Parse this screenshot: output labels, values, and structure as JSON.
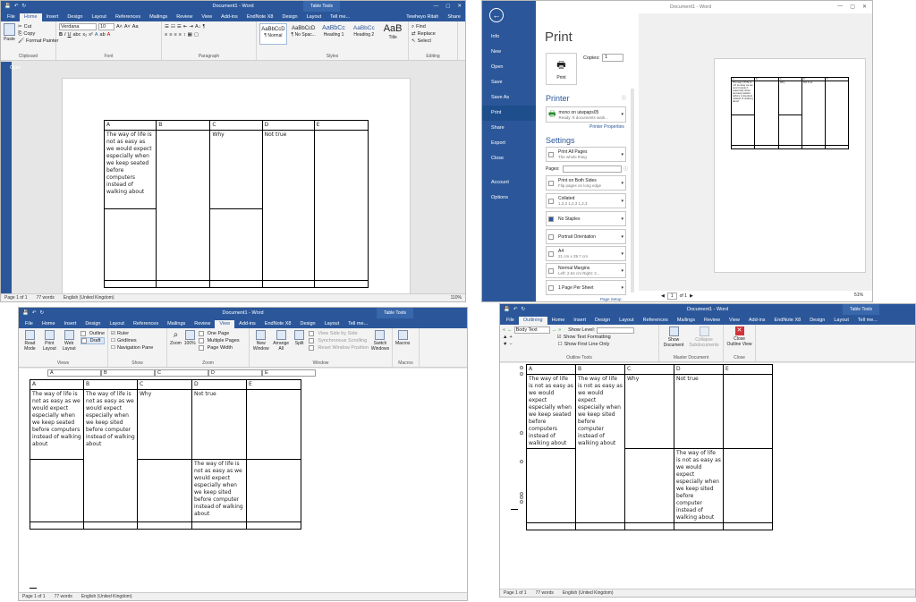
{
  "common": {
    "doc_title": "Document1 - Word",
    "table_tools": "Table Tools",
    "user": "Tewheyo Ritah",
    "share": "Share",
    "tell_me": "Tell me...",
    "ctl": {
      "min": "—",
      "max": "▢",
      "close": "✕"
    },
    "col_letters": [
      "A",
      "B",
      "C",
      "D",
      "E"
    ],
    "cell_text_1": "The way of life is not as easy as we would expect especially when we keep seated before computers instead of walking about",
    "cell_text_2": "The way of life is not as easy as we would expect especially when we keep sited before computer instead of walking about",
    "cell_why": "Why",
    "cell_not_true": "Not true"
  },
  "win1": {
    "tabs": [
      "File",
      "Home",
      "Insert",
      "Design",
      "Layout",
      "References",
      "Mailings",
      "Review",
      "View",
      "Add-ins",
      "EndNote X8",
      "Design",
      "Layout"
    ],
    "clipboard": {
      "paste": "Paste",
      "cut": "Cut",
      "copy": "Copy",
      "painter": "Format Painter",
      "label": "Clipboard"
    },
    "font": {
      "name": "Verdana",
      "size": "10",
      "label": "Font"
    },
    "paragraph_label": "Paragraph",
    "styles": [
      {
        "sample": "AaBbCcD",
        "name": "¶ Normal"
      },
      {
        "sample": "AaBbCcD",
        "name": "¶ No Spac..."
      },
      {
        "sample": "AaBbCc",
        "name": "Heading 1"
      },
      {
        "sample": "AaBbCc",
        "name": "Heading 2"
      },
      {
        "sample": "AaB",
        "name": "Title"
      }
    ],
    "styles_label": "Styles",
    "editing": {
      "find": "Find",
      "replace": "Replace",
      "select": "Select",
      "label": "Editing"
    },
    "nav_open": "Open",
    "status": {
      "page": "Page 1 of 1",
      "words": "77 words",
      "lang": "English (United Kingdom)",
      "zoom": "110%"
    }
  },
  "win2": {
    "side": [
      "Info",
      "New",
      "Open",
      "Save",
      "Save As",
      "Print",
      "Share",
      "Export",
      "Close",
      "Account",
      "Options"
    ],
    "heading": "Print",
    "copies_label": "Copies:",
    "copies_value": "1",
    "print_btn": "Print",
    "printer_heading": "Printer",
    "printer_name": "mono on uiwpaps05",
    "printer_status": "Ready: 8 documents waiti...",
    "printer_props": "Printer Properties",
    "settings_heading": "Settings",
    "settings": [
      {
        "main": "Print All Pages",
        "sub": "The whole thing"
      },
      {
        "main": "Print on Both Sides",
        "sub": "Flip pages on long edge"
      },
      {
        "main": "Collated",
        "sub": "1,2,3   1,2,3   1,2,3"
      },
      {
        "main": "No Staples",
        "sub": ""
      },
      {
        "main": "Portrait Orientation",
        "sub": ""
      },
      {
        "main": "A4",
        "sub": "21 cm x 29.7 cm"
      },
      {
        "main": "Normal Margins",
        "sub": "Left: 2.54 cm   Right: 2..."
      },
      {
        "main": "1 Page Per Sheet",
        "sub": ""
      }
    ],
    "pages_label": "Pages:",
    "page_setup": "Page Setup",
    "nav_page": "1",
    "nav_of": "of 1",
    "zoom": "51%"
  },
  "win3": {
    "tabs": [
      "File",
      "Home",
      "Insert",
      "Design",
      "Layout",
      "References",
      "Mailings",
      "Review",
      "View",
      "Add-ins",
      "EndNote X8",
      "Design",
      "Layout"
    ],
    "views": {
      "read": "Read Mode",
      "print": "Print Layout",
      "web": "Web Layout",
      "outline": "Outline",
      "draft": "Draft",
      "label": "Views"
    },
    "show": {
      "ruler": "Ruler",
      "gridlines": "Gridlines",
      "nav": "Navigation Pane",
      "label": "Show"
    },
    "zoom": {
      "zoom": "Zoom",
      "hundred": "100%",
      "one": "One Page",
      "multi": "Multiple Pages",
      "width": "Page Width",
      "label": "Zoom"
    },
    "window": {
      "new": "New Window",
      "arrange": "Arrange All",
      "split": "Split",
      "side": "View Side by Side",
      "sync": "Synchronous Scrolling",
      "reset": "Reset Window Position",
      "switch": "Switch Windows",
      "label": "Window"
    },
    "macros": {
      "macros": "Macros",
      "label": "Macros"
    },
    "status": {
      "page": "Page 1 of 1",
      "words": "77 words",
      "lang": "English (United Kingdom)"
    }
  },
  "win4": {
    "tabs": [
      "File",
      "Outlining",
      "Home",
      "Insert",
      "Design",
      "Layout",
      "References",
      "Mailings",
      "Review",
      "View",
      "Add-ins",
      "EndNote X8",
      "Design",
      "Layout"
    ],
    "level": "Body Text",
    "show_level": "Show Level:",
    "show_text_fmt": "Show Text Formatting",
    "show_first": "Show First Line Only",
    "outline_label": "Outline Tools",
    "show_doc": "Show Document",
    "collapse": "Collapse Subdocuments",
    "master_label": "Master Document",
    "close_outline": "Close Outline View",
    "close_label": "Close",
    "status": {
      "page": "Page 1 of 1",
      "words": "77 words",
      "lang": "English (United Kingdom)"
    }
  }
}
